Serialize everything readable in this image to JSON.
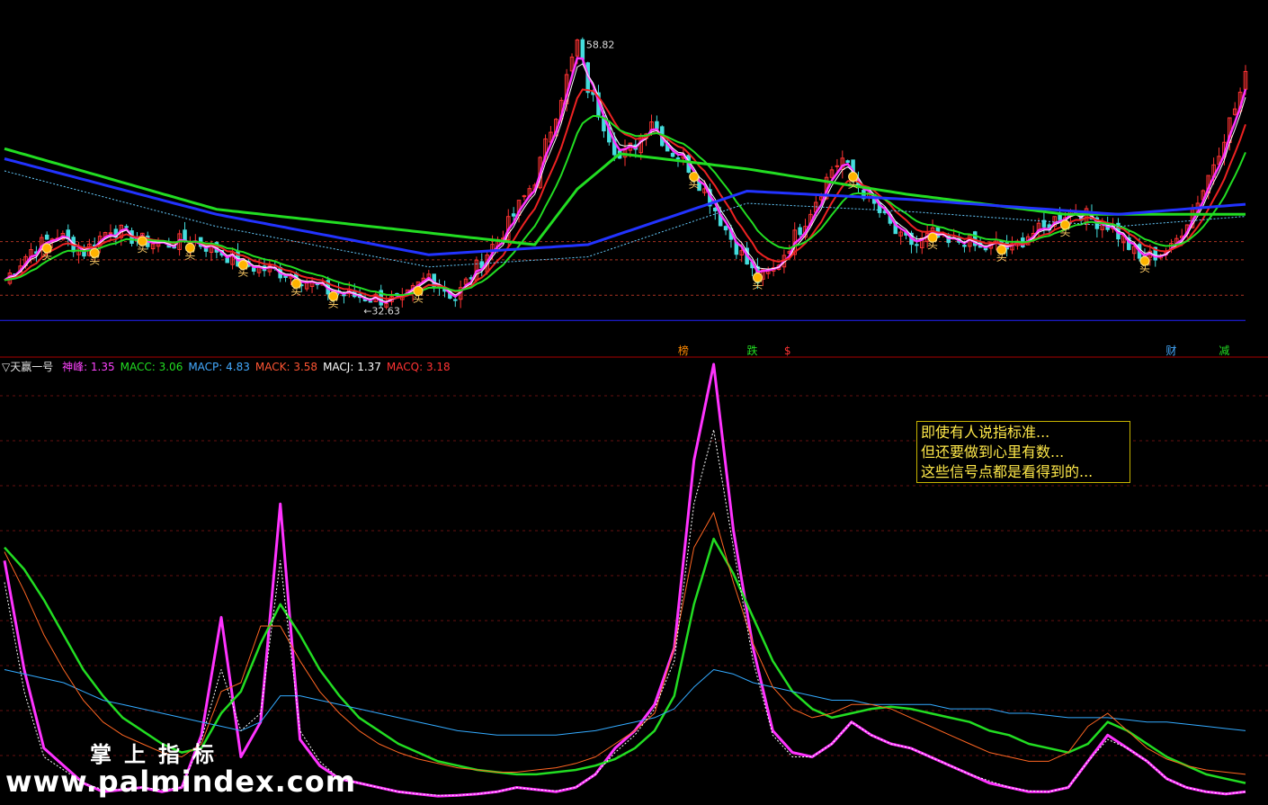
{
  "indicator": {
    "name": "▽天赢一号",
    "items": [
      {
        "label": "神峰:",
        "value": "1.35",
        "color": "#ff44ff"
      },
      {
        "label": "MACC:",
        "value": "3.06",
        "color": "#22dd22"
      },
      {
        "label": "MACP:",
        "value": "4.83",
        "color": "#44aaff"
      },
      {
        "label": "MACK:",
        "value": "3.58",
        "color": "#ff5533"
      },
      {
        "label": "MACJ:",
        "value": "1.37",
        "color": "#ffffff"
      },
      {
        "label": "MACQ:",
        "value": "3.18",
        "color": "#ff3333"
      }
    ]
  },
  "note": {
    "lines": [
      "即使有人说指标准...",
      "但还要做到心里有数...",
      "这些信号点都是看得到的..."
    ]
  },
  "watermark": {
    "line1": "掌上指标",
    "line2": "www.palmindex.com"
  },
  "colors": {
    "background": "#000000",
    "up_candle": "#ff3333",
    "down_candle": "#44dddd",
    "magenta": "#ff33ff",
    "green": "#22dd22",
    "red": "#ee2222",
    "blue": "#2233ff",
    "cyan": "#33aaff",
    "orange": "#ff6622",
    "divider": "#aa0000"
  },
  "chart_data": [
    {
      "type": "candlestick",
      "panel": "main",
      "ylim": [
        28,
        62
      ],
      "annotations": [
        {
          "text": "58.82",
          "kind": "high"
        },
        {
          "text": "32.63",
          "kind": "low"
        }
      ],
      "signal_labels": [
        "买",
        "买",
        "买",
        "买",
        "买",
        "买",
        "买",
        "买",
        "买",
        "买",
        "买",
        "买",
        "买",
        "买",
        "买"
      ],
      "bottom_labels": [
        {
          "text": "榜",
          "color": "#ff8800"
        },
        {
          "text": "跌",
          "color": "#22dd22"
        },
        {
          "text": "$",
          "color": "#ff3333"
        },
        {
          "text": "财",
          "color": "#44aaff"
        },
        {
          "text": "减",
          "color": "#22dd22"
        }
      ],
      "price_path": [
        [
          0,
          35.0
        ],
        [
          5,
          38.0
        ],
        [
          10,
          39.5
        ],
        [
          15,
          37.8
        ],
        [
          20,
          40.2
        ],
        [
          25,
          39.0
        ],
        [
          30,
          38.5
        ],
        [
          35,
          39.0
        ],
        [
          40,
          38.0
        ],
        [
          45,
          36.5
        ],
        [
          50,
          36.0
        ],
        [
          55,
          35.5
        ],
        [
          60,
          34.0
        ],
        [
          65,
          33.5
        ],
        [
          70,
          33.2
        ],
        [
          75,
          32.8
        ],
        [
          80,
          35.5
        ],
        [
          85,
          33.2
        ],
        [
          90,
          37.0
        ],
        [
          95,
          40.5
        ],
        [
          100,
          45.0
        ],
        [
          103,
          50.0
        ],
        [
          106,
          55.0
        ],
        [
          108,
          58.5
        ],
        [
          110,
          54.0
        ],
        [
          113,
          50.5
        ],
        [
          116,
          47.0
        ],
        [
          119,
          48.5
        ],
        [
          122,
          51.0
        ],
        [
          125,
          48.0
        ],
        [
          128,
          47.0
        ],
        [
          130,
          45.5
        ],
        [
          133,
          43.0
        ],
        [
          136,
          40.0
        ],
        [
          139,
          37.5
        ],
        [
          142,
          35.0
        ],
        [
          145,
          36.0
        ],
        [
          148,
          38.5
        ],
        [
          151,
          41.0
        ],
        [
          154,
          44.0
        ],
        [
          156,
          46.0
        ],
        [
          158,
          47.0
        ],
        [
          160,
          45.0
        ],
        [
          163,
          43.0
        ],
        [
          166,
          41.0
        ],
        [
          169,
          39.0
        ],
        [
          172,
          38.5
        ],
        [
          175,
          39.5
        ],
        [
          178,
          38.5
        ],
        [
          181,
          39.0
        ],
        [
          184,
          38.0
        ],
        [
          187,
          38.5
        ],
        [
          190,
          38.0
        ],
        [
          193,
          39.5
        ],
        [
          196,
          40.0
        ],
        [
          199,
          41.5
        ],
        [
          202,
          42.0
        ],
        [
          205,
          41.0
        ],
        [
          208,
          40.5
        ],
        [
          211,
          39.0
        ],
        [
          214,
          37.0
        ],
        [
          217,
          37.5
        ],
        [
          220,
          38.0
        ],
        [
          223,
          41.0
        ],
        [
          226,
          44.0
        ],
        [
          229,
          48.0
        ],
        [
          232,
          52.0
        ],
        [
          234,
          55.0
        ]
      ],
      "ma_slow_green": [
        [
          0,
          48.0
        ],
        [
          40,
          42.0
        ],
        [
          100,
          38.5
        ],
        [
          108,
          44.0
        ],
        [
          116,
          47.5
        ],
        [
          140,
          46.0
        ],
        [
          170,
          43.5
        ],
        [
          200,
          41.5
        ],
        [
          234,
          41.5
        ]
      ],
      "ma_blue": [
        [
          0,
          47.0
        ],
        [
          40,
          41.5
        ],
        [
          80,
          37.5
        ],
        [
          110,
          38.5
        ],
        [
          140,
          43.8
        ],
        [
          170,
          43.0
        ],
        [
          210,
          41.5
        ],
        [
          234,
          42.5
        ]
      ],
      "hlines": [
        37.0,
        38.8,
        33.5,
        31.0
      ]
    },
    {
      "type": "line",
      "panel": "indicator",
      "ylim": [
        0,
        10
      ],
      "series": [
        {
          "name": "神峰",
          "values": [
            5.5,
            3.0,
            1.2,
            0.8,
            0.4,
            0.2,
            0.25,
            0.3,
            0.2,
            0.3,
            1.5,
            4.2,
            1.0,
            1.8,
            6.8,
            1.4,
            0.8,
            0.5,
            0.4,
            0.3,
            0.2,
            0.15,
            0.1,
            0.12,
            0.15,
            0.2,
            0.3,
            0.25,
            0.2,
            0.3,
            0.6,
            1.2,
            1.6,
            2.2,
            3.5,
            7.8,
            10.0,
            6.2,
            3.5,
            1.6,
            1.1,
            1.0,
            1.3,
            1.8,
            1.5,
            1.3,
            1.2,
            1.0,
            0.8,
            0.6,
            0.4,
            0.3,
            0.2,
            0.2,
            0.3,
            0.9,
            1.5,
            1.2,
            0.9,
            0.5,
            0.3,
            0.2,
            0.15,
            0.2
          ]
        },
        {
          "name": "MACC",
          "values": [
            5.8,
            5.3,
            4.6,
            3.8,
            3.0,
            2.4,
            1.9,
            1.6,
            1.3,
            1.1,
            1.2,
            2.0,
            2.5,
            3.6,
            4.5,
            3.8,
            3.0,
            2.4,
            1.9,
            1.6,
            1.3,
            1.1,
            0.9,
            0.8,
            0.7,
            0.65,
            0.6,
            0.6,
            0.65,
            0.7,
            0.8,
            0.95,
            1.2,
            1.6,
            2.4,
            4.5,
            6.0,
            5.2,
            4.2,
            3.2,
            2.5,
            2.1,
            1.9,
            2.0,
            2.1,
            2.15,
            2.1,
            2.0,
            1.9,
            1.8,
            1.6,
            1.5,
            1.3,
            1.2,
            1.1,
            1.3,
            1.8,
            1.6,
            1.3,
            1.0,
            0.8,
            0.6,
            0.5,
            0.4
          ]
        },
        {
          "name": "MACP",
          "values": [
            3.0,
            2.9,
            2.8,
            2.7,
            2.5,
            2.3,
            2.2,
            2.1,
            2.0,
            1.9,
            1.8,
            1.7,
            1.6,
            1.8,
            2.4,
            2.4,
            2.3,
            2.2,
            2.1,
            2.0,
            1.9,
            1.8,
            1.7,
            1.6,
            1.55,
            1.5,
            1.5,
            1.5,
            1.5,
            1.55,
            1.6,
            1.7,
            1.8,
            1.9,
            2.1,
            2.6,
            3.0,
            2.9,
            2.7,
            2.6,
            2.5,
            2.4,
            2.3,
            2.3,
            2.2,
            2.2,
            2.2,
            2.2,
            2.1,
            2.1,
            2.1,
            2.0,
            2.0,
            1.95,
            1.9,
            1.9,
            1.9,
            1.85,
            1.8,
            1.8,
            1.75,
            1.7,
            1.65,
            1.6
          ]
        },
        {
          "name": "MACK",
          "values": [
            5.7,
            4.8,
            3.8,
            3.0,
            2.3,
            1.8,
            1.5,
            1.3,
            1.1,
            1.0,
            1.3,
            2.5,
            2.7,
            4.0,
            4.0,
            3.2,
            2.5,
            2.0,
            1.6,
            1.3,
            1.1,
            0.95,
            0.85,
            0.75,
            0.7,
            0.65,
            0.65,
            0.7,
            0.75,
            0.85,
            1.0,
            1.3,
            1.6,
            2.0,
            3.5,
            5.8,
            6.6,
            5.0,
            3.6,
            2.6,
            2.1,
            1.9,
            2.0,
            2.2,
            2.2,
            2.1,
            1.9,
            1.7,
            1.5,
            1.3,
            1.1,
            1.0,
            0.9,
            0.9,
            1.1,
            1.7,
            2.0,
            1.6,
            1.2,
            0.95,
            0.8,
            0.7,
            0.65,
            0.6
          ]
        },
        {
          "name": "MACJ",
          "values": [
            5.0,
            2.5,
            1.0,
            0.7,
            0.4,
            0.25,
            0.25,
            0.3,
            0.25,
            0.3,
            1.4,
            3.0,
            1.6,
            2.0,
            5.5,
            1.6,
            0.9,
            0.5,
            0.4,
            0.3,
            0.2,
            0.15,
            0.12,
            0.12,
            0.15,
            0.2,
            0.3,
            0.25,
            0.22,
            0.3,
            0.6,
            1.1,
            1.5,
            2.1,
            3.2,
            6.8,
            8.5,
            5.8,
            3.2,
            1.5,
            1.0,
            1.0,
            1.3,
            1.8,
            1.5,
            1.3,
            1.2,
            1.0,
            0.8,
            0.6,
            0.45,
            0.3,
            0.22,
            0.2,
            0.3,
            0.9,
            1.4,
            1.2,
            0.9,
            0.5,
            0.3,
            0.2,
            0.15,
            0.2
          ]
        }
      ]
    }
  ]
}
